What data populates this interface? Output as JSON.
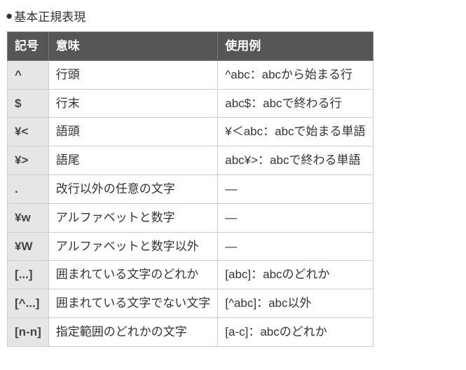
{
  "title_bullet": "●",
  "title_text": "基本正規表現",
  "table": {
    "headers": {
      "symbol": "記号",
      "meaning": "意味",
      "example": "使用例"
    },
    "rows": [
      {
        "symbol": "^",
        "meaning": "行頭",
        "example": "^abc：abcから始まる行"
      },
      {
        "symbol": "$",
        "meaning": "行末",
        "example": "abc$：abcで終わる行"
      },
      {
        "symbol": "¥<",
        "meaning": "語頭",
        "example": "¥＜abc：abcで始まる単語"
      },
      {
        "symbol": "¥>",
        "meaning": "語尾",
        "example": "abc¥>：abcで終わる単語"
      },
      {
        "symbol": ".",
        "meaning": "改行以外の任意の文字",
        "example": "―"
      },
      {
        "symbol": "¥w",
        "meaning": "アルファベットと数字",
        "example": "―"
      },
      {
        "symbol": "¥W",
        "meaning": "アルファベットと数字以外",
        "example": "―"
      },
      {
        "symbol": "[...]",
        "meaning": "囲まれている文字のどれか",
        "example": "[abc]：abcのどれか"
      },
      {
        "symbol": "[^...]",
        "meaning": "囲まれている文字でない文字",
        "example": "[^abc]：abc以外"
      },
      {
        "symbol": "[n-n]",
        "meaning": "指定範囲のどれかの文字",
        "example": "[a-c]：abcのどれか"
      }
    ]
  }
}
